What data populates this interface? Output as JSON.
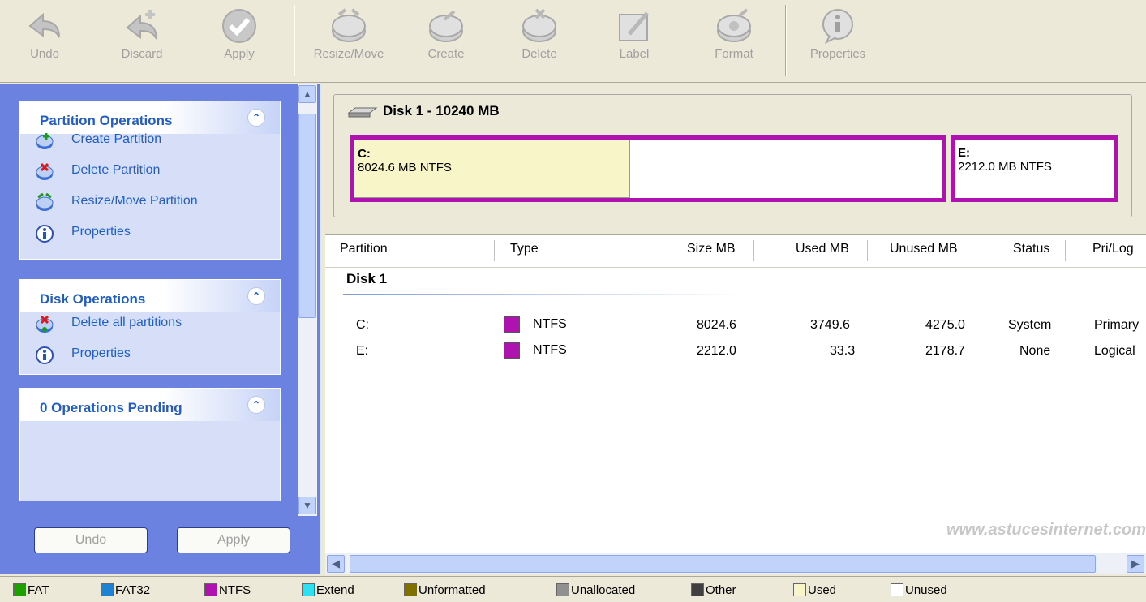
{
  "toolbar": {
    "undo": "Undo",
    "discard": "Discard",
    "apply": "Apply",
    "resize_move": "Resize/Move",
    "create": "Create",
    "delete": "Delete",
    "label": "Label",
    "format": "Format",
    "properties": "Properties"
  },
  "sidebar": {
    "partition_ops": {
      "title": "Partition Operations",
      "items": [
        {
          "label": "Create Partition",
          "icon": "create-partition-icon"
        },
        {
          "label": "Delete Partition",
          "icon": "delete-partition-icon"
        },
        {
          "label": "Resize/Move Partition",
          "icon": "resize-partition-icon"
        },
        {
          "label": "Properties",
          "icon": "info-icon"
        }
      ]
    },
    "disk_ops": {
      "title": "Disk Operations",
      "items": [
        {
          "label": "Delete all partitions",
          "icon": "delete-all-icon"
        },
        {
          "label": "Properties",
          "icon": "info-icon"
        }
      ]
    },
    "pending": {
      "title": "0 Operations Pending"
    },
    "undo_button": "Undo",
    "apply_button": "Apply"
  },
  "disk_map": {
    "title": "Disk 1 - 10240 MB",
    "partitions": [
      {
        "letter": "C:",
        "info": "8024.6 MB  NTFS",
        "used_fraction": 0.47
      },
      {
        "letter": "E:",
        "info": "2212.0 MB  NTFS",
        "used_fraction": 0.015
      }
    ]
  },
  "list": {
    "headers": [
      "Partition",
      "Type",
      "Size MB",
      "Used MB",
      "Unused MB",
      "Status",
      "Pri/Log"
    ],
    "group": "Disk 1",
    "rows": [
      {
        "partition": "C:",
        "type": "NTFS",
        "size": "8024.6",
        "used": "3749.6",
        "unused": "4275.0",
        "status": "System",
        "prilog": "Primary"
      },
      {
        "partition": "E:",
        "type": "NTFS",
        "size": "2212.0",
        "used": "33.3",
        "unused": "2178.7",
        "status": "None",
        "prilog": "Logical"
      }
    ],
    "watermark": "www.astucesinternet.com"
  },
  "legend": [
    {
      "label": "FAT",
      "color": "#1ea000"
    },
    {
      "label": "FAT32",
      "color": "#1e82d2"
    },
    {
      "label": "NTFS",
      "color": "#b012b0"
    },
    {
      "label": "Extend",
      "color": "#30e0f0"
    },
    {
      "label": "Unformatted",
      "color": "#807000"
    },
    {
      "label": "Unallocated",
      "color": "#909090"
    },
    {
      "label": "Other",
      "color": "#404040"
    },
    {
      "label": "Used",
      "color": "#f8f5c8"
    },
    {
      "label": "Unused",
      "color": "#ffffff"
    }
  ],
  "colors": {
    "ntfs": "#b012b0",
    "panel_bg": "#6b82e0",
    "link": "#215dc6"
  }
}
